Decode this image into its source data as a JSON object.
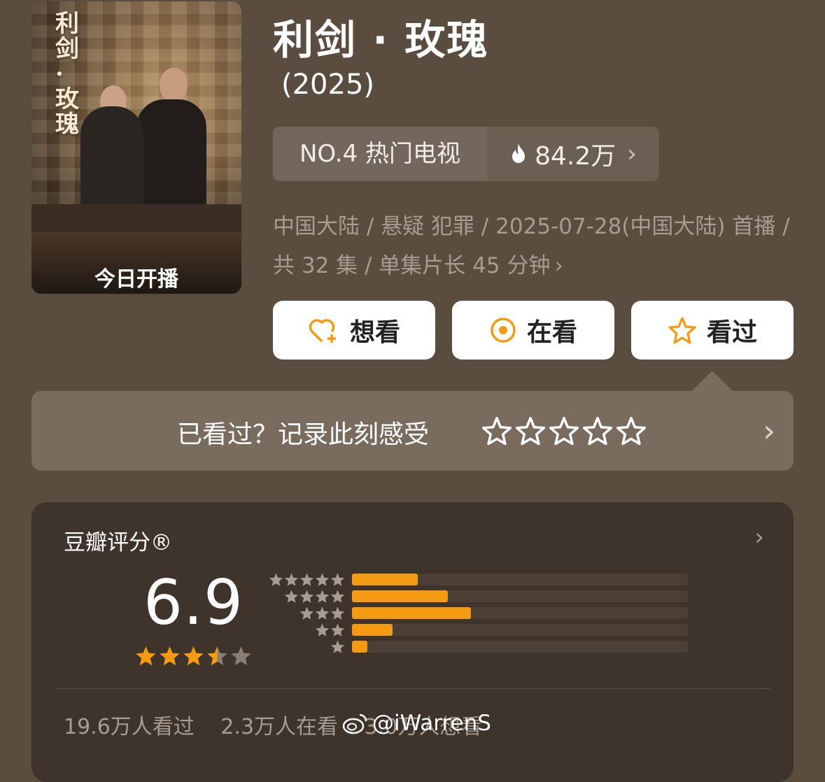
{
  "poster": {
    "title_art": "利剑·玫瑰",
    "banner": "今日开播"
  },
  "header": {
    "title": "利剑 · 玫瑰",
    "year": "(2025)"
  },
  "rank": {
    "label": "NO.4 热门电视",
    "heat": "84.2万"
  },
  "meta": {
    "line": "中国大陆 / 悬疑 犯罪 / 2025-07-28(中国大陆) 首播 / 共 32 集 / 单集片长 45 分钟"
  },
  "actions": {
    "want": "想看",
    "watching": "在看",
    "watched": "看过"
  },
  "record": {
    "prompt": "已看过？记录此刻感受",
    "stars": 5
  },
  "rating": {
    "label": "豆瓣评分®",
    "score": "6.9",
    "stars_value": 3.5,
    "distribution": [
      {
        "stars": 5,
        "fraction": 0.195
      },
      {
        "stars": 4,
        "fraction": 0.285
      },
      {
        "stars": 3,
        "fraction": 0.355
      },
      {
        "stars": 2,
        "fraction": 0.12
      },
      {
        "stars": 1,
        "fraction": 0.045
      }
    ],
    "watched": "19.6万人看过",
    "watching": "2.3万人在看",
    "want": "3.0万人想看"
  },
  "watermark": "@iWarrenS",
  "colors": {
    "background": "#5b4c40",
    "accent": "#f59b13",
    "card": "#3f342b"
  }
}
